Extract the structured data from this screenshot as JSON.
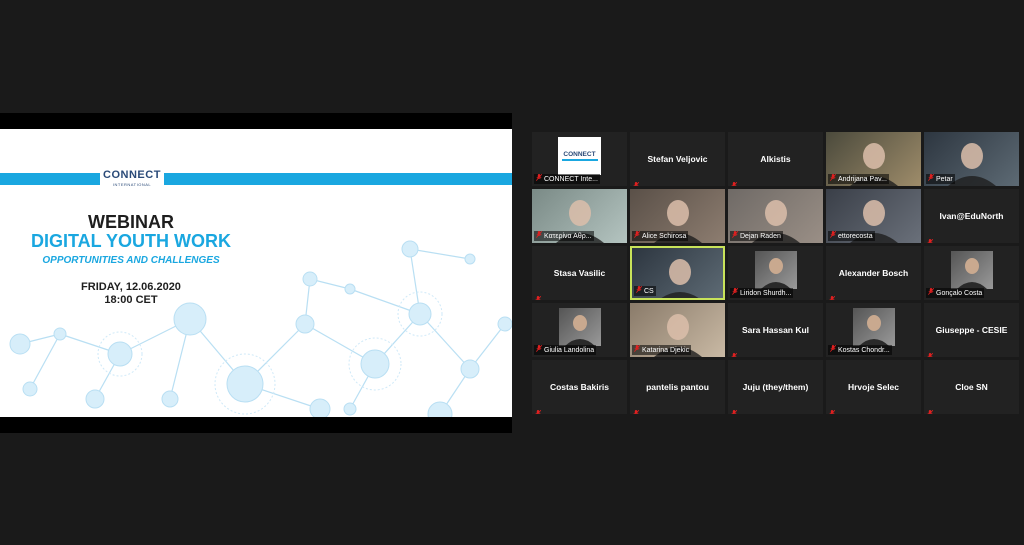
{
  "slide": {
    "logo_text": "CONNECT",
    "logo_sub": "INTERNATIONAL",
    "title": "WEBINAR",
    "subtitle": "DIGITAL YOUTH WORK",
    "tagline": "OPPORTUNITIES AND CHALLENGES",
    "date": "FRIDAY, 12.06.2020",
    "time": "18:00 CET"
  },
  "participants": [
    {
      "name": "CONNECT Inte...",
      "video": "logo",
      "label": true
    },
    {
      "name": "Stefan Veljovic",
      "video": "none",
      "label": false
    },
    {
      "name": "Alkistis",
      "video": "none",
      "label": false
    },
    {
      "name": "Andrijana Pav...",
      "video": "cam",
      "label": true
    },
    {
      "name": "Petar",
      "video": "cam",
      "label": true
    },
    {
      "name": "Κατερίνα Αθρ...",
      "video": "cam",
      "label": true
    },
    {
      "name": "Alice Schirosa",
      "video": "cam",
      "label": true
    },
    {
      "name": "Dejan Raden",
      "video": "cam",
      "label": true
    },
    {
      "name": "ettorecosta",
      "video": "cam",
      "label": true
    },
    {
      "name": "Ivan@EduNorth",
      "video": "none",
      "label": false
    },
    {
      "name": "Stasa Vasilic",
      "video": "none",
      "label": false
    },
    {
      "name": "CS",
      "video": "cam",
      "label": true,
      "active": true
    },
    {
      "name": "Liridon Shurdh...",
      "video": "thumb",
      "label": true
    },
    {
      "name": "Alexander Bosch",
      "video": "none",
      "label": false
    },
    {
      "name": "Gonçalo Costa",
      "video": "thumb",
      "label": true
    },
    {
      "name": "Giulia Landolina",
      "video": "thumb",
      "label": true
    },
    {
      "name": "Katarina Djekic",
      "video": "cam",
      "label": true
    },
    {
      "name": "Sara Hassan Kul",
      "video": "none",
      "label": false
    },
    {
      "name": "Kostas Chondr...",
      "video": "thumb",
      "label": true
    },
    {
      "name": "Giuseppe - CESIE",
      "video": "none",
      "label": false
    },
    {
      "name": "Costas Bakiris",
      "video": "none",
      "label": false
    },
    {
      "name": "pantelis pantou",
      "video": "none",
      "label": false
    },
    {
      "name": "Juju (they/them)",
      "video": "none",
      "label": false
    },
    {
      "name": "Hrvoje Selec",
      "video": "none",
      "label": false
    },
    {
      "name": "Cloe SN",
      "video": "none",
      "label": false
    }
  ],
  "colors": {
    "accent": "#1aa7e0",
    "active_border": "#c8e35a",
    "mic_muted": "#e02020",
    "tile_bg": "#222222",
    "page_bg": "#1a1a1a"
  }
}
